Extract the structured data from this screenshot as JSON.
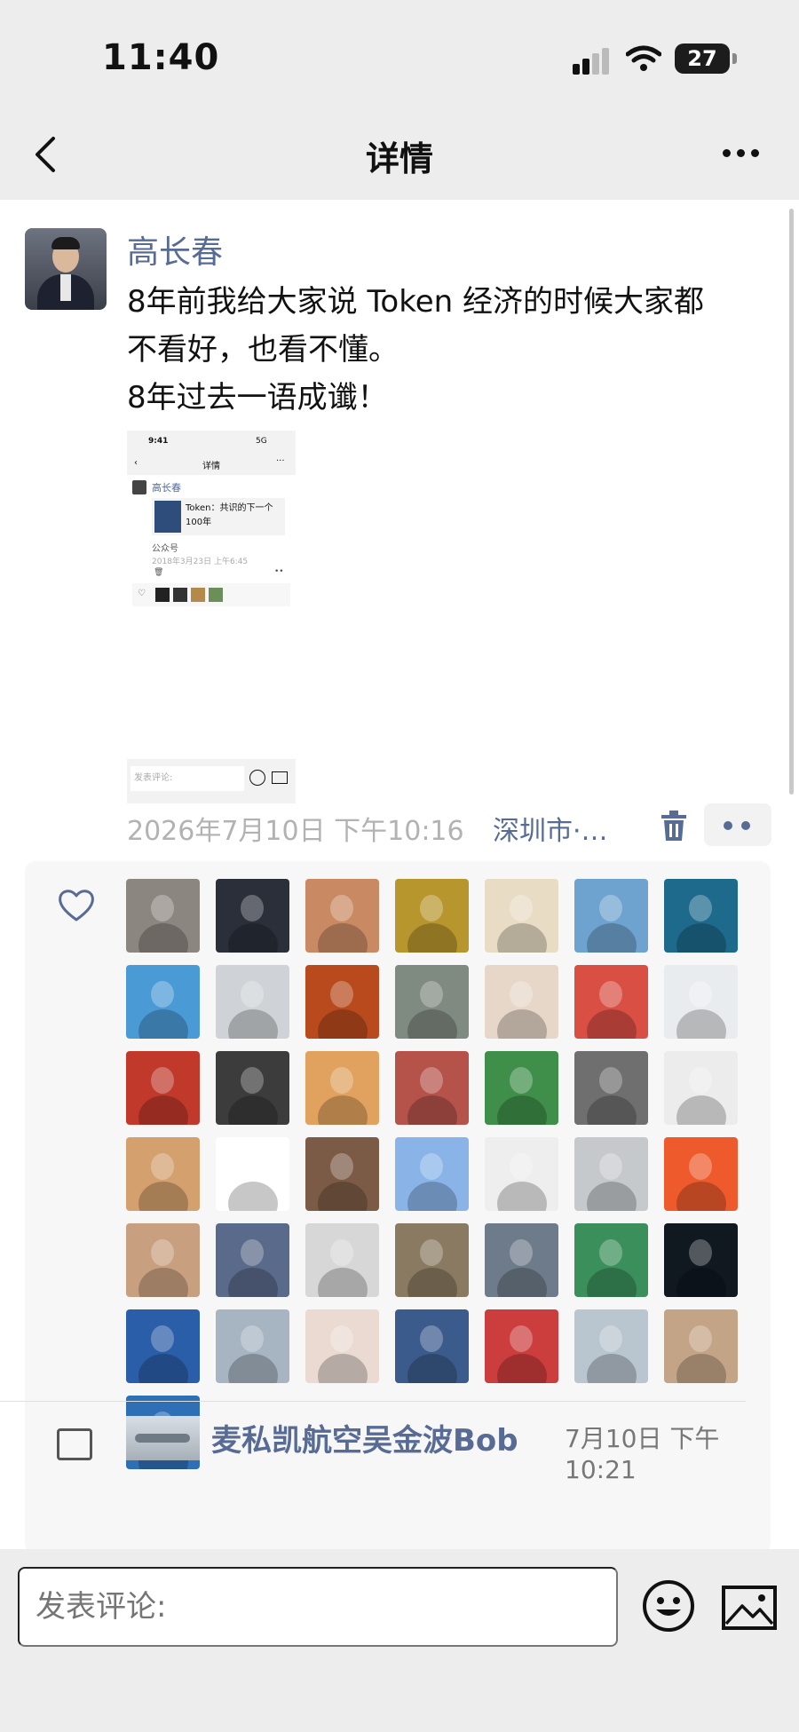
{
  "status_bar": {
    "time": "11:40",
    "battery": "27"
  },
  "nav": {
    "title": "详情"
  },
  "post": {
    "author": "高长春",
    "text": "8年前我给大家说 Token 经济的时候大家都\n不看好，也看不懂。\n8年过去一语成谶！",
    "time": "2026年7月10日 下午10:16",
    "location": "深圳市·…"
  },
  "embedded_screenshot": {
    "time": "9:41",
    "network": "5G",
    "title": "详情",
    "author": "高长春",
    "card_text": "Token：共识的下一个100年",
    "card_source": "公众号",
    "date": "2018年3月23日 上午6:45",
    "comment_placeholder": "发表评论:"
  },
  "likes": {
    "avatar_colors": [
      "#8c8680",
      "#2a2f3a",
      "#c98a63",
      "#b8962e",
      "#e8dcc4",
      "#6fa3cf",
      "#1e6a8c",
      "#4a9ad6",
      "#cfd3d7",
      "#b84a1d",
      "#7f8a80",
      "#e6d7c8",
      "#d94f44",
      "#e9ecef",
      "#c0392b",
      "#3c3c3c",
      "#e0a25e",
      "#b5524a",
      "#3f8f4a",
      "#6f6f6f",
      "#ececec",
      "#d3a06e",
      "#ffffff",
      "#7b5b46",
      "#8ab4e8",
      "#eeeeee",
      "#c6c9cc",
      "#ee5a2c",
      "#c9a07f",
      "#5a6a8a",
      "#d7d7d7",
      "#8a7a62",
      "#6e7b8a",
      "#3a8f5a",
      "#101820",
      "#2b5ea8",
      "#a7b4c2",
      "#eadad2",
      "#3b5b8c",
      "#cc3d3d",
      "#b9c5cf",
      "#c4a486",
      "#2f6fb5"
    ]
  },
  "comment": {
    "commenter": "麦私凯航空吴金波Bob",
    "time": "7月10日 下午10:21"
  },
  "comment_bar": {
    "placeholder": "发表评论:"
  },
  "icons": {
    "back": "chevron-left-icon",
    "more": "more-dots-icon",
    "trash": "trash-icon",
    "heart": "heart-icon",
    "comment": "comment-icon",
    "emoji": "emoji-icon",
    "image": "image-icon"
  },
  "colors": {
    "link": "#576b95",
    "meta": "#b2b2b2"
  }
}
